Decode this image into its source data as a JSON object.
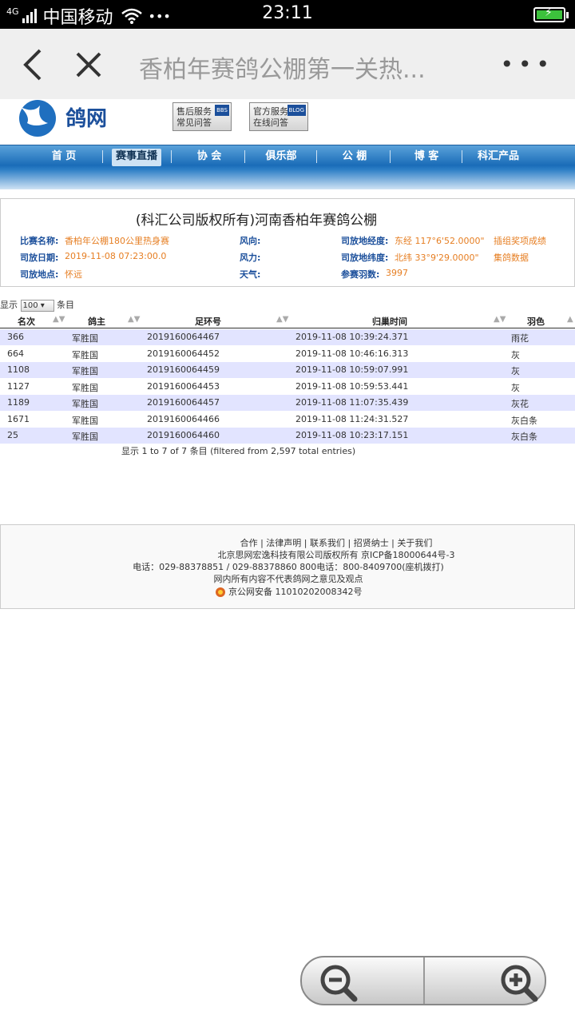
{
  "status": {
    "network": "4G",
    "carrier": "中国移动",
    "dots": "•••",
    "time": "23:11"
  },
  "browser": {
    "title": "香柏年赛鸽公棚第一关热...",
    "more": "•••"
  },
  "site": {
    "logo_text": "鸽网",
    "btn1": [
      "售后服务",
      "常见问答"
    ],
    "btn1_tag": "BBS",
    "btn2": [
      "官方服务",
      "在线问答"
    ],
    "btn2_tag": "BLOG",
    "nav": [
      "首 页",
      "赛事直播",
      "协 会",
      "俱乐部",
      "公 棚",
      "博 客",
      "科汇产品"
    ]
  },
  "race": {
    "title": "(科汇公司版权所有)河南香柏年赛鸽公棚",
    "name_label": "比赛名称:",
    "name": "香柏年公棚180公里热身赛",
    "date_label": "司放日期:",
    "date": "2019-11-08 07:23:00.0",
    "place_label": "司放地点:",
    "place": "怀远",
    "wind_dir_label": "风向:",
    "wind_force_label": "风力:",
    "weather_label": "天气:",
    "lon_label": "司放地经度:",
    "lon": "东经 117°6'52.0000\"",
    "lat_label": "司放地纬度:",
    "lat": "北纬 33°9'29.0000\"",
    "count_label": "参赛羽数:",
    "count": "3997",
    "link1": "插组奖项成绩",
    "link2": "集鸽数据"
  },
  "table": {
    "show_prefix": "显示",
    "page_size": "100",
    "show_suffix": "条目",
    "columns": [
      "名次",
      "鸽主",
      "足环号",
      "归巢时间",
      "羽色"
    ],
    "rows": [
      [
        "366",
        "军胜国",
        "2019160064467",
        "2019-11-08 10:39:24.371",
        "雨花"
      ],
      [
        "664",
        "军胜国",
        "2019160064452",
        "2019-11-08 10:46:16.313",
        "灰"
      ],
      [
        "1108",
        "军胜国",
        "2019160064459",
        "2019-11-08 10:59:07.991",
        "灰"
      ],
      [
        "1127",
        "军胜国",
        "2019160064453",
        "2019-11-08 10:59:53.441",
        "灰"
      ],
      [
        "1189",
        "军胜国",
        "2019160064457",
        "2019-11-08 11:07:35.439",
        "灰花"
      ],
      [
        "1671",
        "军胜国",
        "2019160064466",
        "2019-11-08 11:24:31.527",
        "灰白条"
      ],
      [
        "25",
        "军胜国",
        "2019160064460",
        "2019-11-08 10:23:17.151",
        "灰白条"
      ]
    ],
    "info": "显示 1 to 7 of 7 条目 (filtered from 2,597 total entries)"
  },
  "footer": {
    "links": "合作 | 法律声明 | 联系我们 | 招贤纳士 | 关于我们",
    "copyright": "北京思网宏逸科技有限公司版权所有 京ICP备18000644号-3",
    "phone": "电话：029-88378851 / 029-88378860   800电话：800-8409700(座机拨打)",
    "disclaimer": "网内所有内容不代表鸽网之意见及观点",
    "police": "京公网安备 11010202008342号"
  }
}
